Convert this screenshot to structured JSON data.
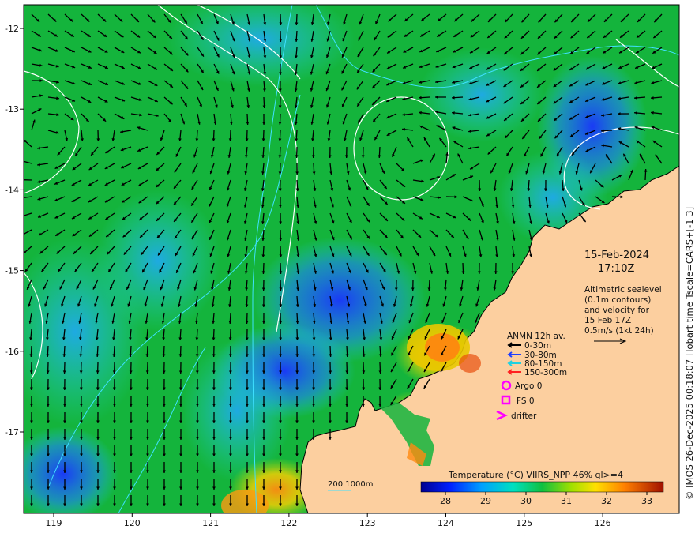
{
  "map": {
    "lon_ticks": [
      "119",
      "120",
      "121",
      "122",
      "123",
      "124",
      "125",
      "126"
    ],
    "lat_ticks": [
      "-12",
      "-13",
      "-14",
      "-15",
      "-16",
      "-17"
    ]
  },
  "datetime": {
    "date": "15-Feb-2024",
    "time": "17:10Z"
  },
  "altimetry_note": [
    "Altimetric sealevel",
    "(0.1m contours)",
    "and velocity for",
    "15 Feb 17Z",
    "0.5m/s (1kt 24h)"
  ],
  "legend": {
    "title": "ANMN 12h av.",
    "depths": [
      {
        "label": "0-30m",
        "color": "#000000"
      },
      {
        "label": "30-80m",
        "color": "#1f3fff"
      },
      {
        "label": "80-150m",
        "color": "#20d0e0"
      },
      {
        "label": "150-300m",
        "color": "#ff2020"
      }
    ],
    "argo": "Argo 0",
    "fs": "FS 0",
    "drifter": "drifter",
    "marker_color": "#ff00ff"
  },
  "bathy_label": "200  1000m",
  "colorbar": {
    "title": "Temperature (°C) VIIRS_NPP 46% ql>=4",
    "ticks": [
      "28",
      "29",
      "30",
      "31",
      "32",
      "33"
    ]
  },
  "credit": "© IMOS 26-Dec-2025 00:18:07 Hobart time Tscale=CARS+[-1 3]",
  "colors": {
    "land": "#fccf9f",
    "sea_green": "#14b43c",
    "contour": "#ffffff",
    "bathy": "#3fe0ff"
  }
}
